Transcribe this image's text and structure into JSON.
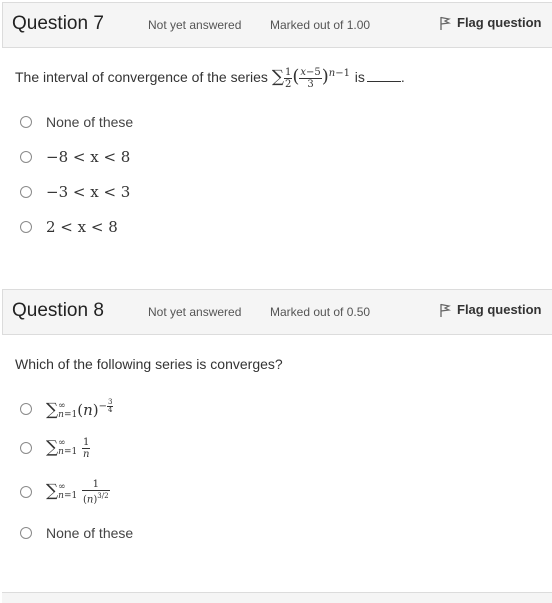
{
  "questions": [
    {
      "title": "Question 7",
      "status": "Not yet answered",
      "marks": "Marked out of 1.00",
      "flag_label": "Flag question",
      "text_before": "The interval of convergence of the series",
      "text_after": "is",
      "options": [
        "None of these",
        "−8 < x < 8",
        "−3 < x < 3",
        "2 < x < 8"
      ]
    },
    {
      "title": "Question 8",
      "status": "Not yet answered",
      "marks": "Marked out of 0.50",
      "flag_label": "Flag question",
      "text": "Which of the following series is converges?",
      "options": [
        "None of these"
      ]
    }
  ],
  "icons": {
    "flag": "flag-icon",
    "radio": "radio-button"
  },
  "colors": {
    "header_bg": "#f5f5f5",
    "border": "#dcdcdc",
    "text": "#333333"
  }
}
